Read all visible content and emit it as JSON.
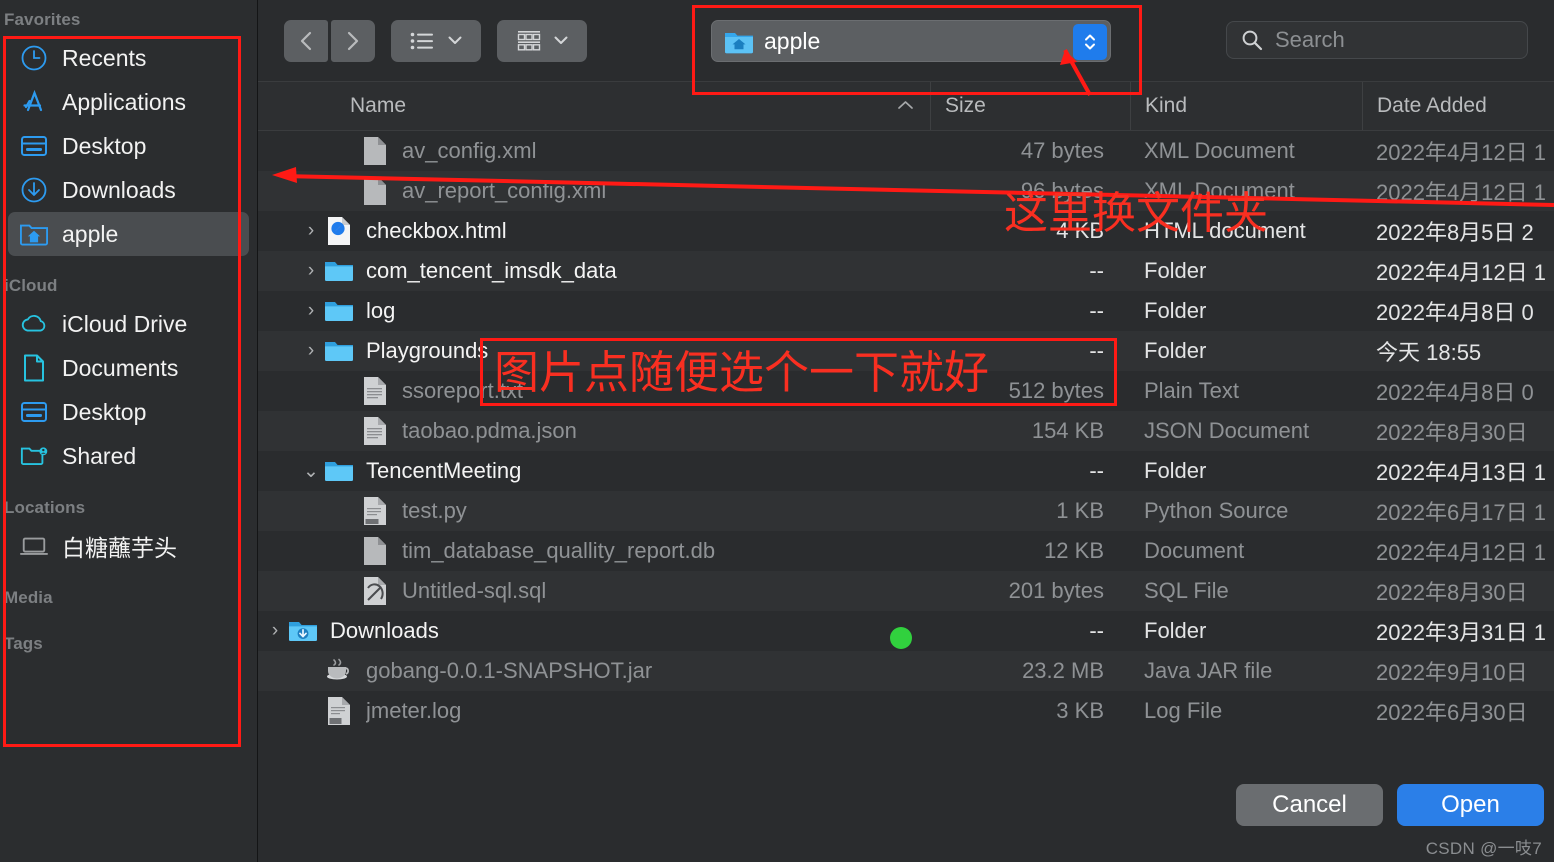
{
  "sidebar": {
    "sections": [
      {
        "header": "Favorites",
        "items": [
          {
            "label": "Recents",
            "icon": "clock-icon",
            "selected": false
          },
          {
            "label": "Applications",
            "icon": "appstore-icon",
            "selected": false
          },
          {
            "label": "Desktop",
            "icon": "desktop-icon",
            "selected": false
          },
          {
            "label": "Downloads",
            "icon": "download-icon",
            "selected": false
          },
          {
            "label": "apple",
            "icon": "home-folder-icon",
            "selected": true
          }
        ]
      },
      {
        "header": "iCloud",
        "items": [
          {
            "label": "iCloud Drive",
            "icon": "cloud-icon",
            "selected": false
          },
          {
            "label": "Documents",
            "icon": "document-icon",
            "selected": false
          },
          {
            "label": "Desktop",
            "icon": "desktop-icon",
            "selected": false
          },
          {
            "label": "Shared",
            "icon": "shared-folder-icon",
            "selected": false
          }
        ]
      },
      {
        "header": "Locations",
        "items": [
          {
            "label": "白糖蘸芋头",
            "icon": "laptop-icon",
            "selected": false
          }
        ]
      },
      {
        "header": "Media",
        "items": []
      },
      {
        "header": "Tags",
        "items": []
      }
    ]
  },
  "toolbar": {
    "back_icon": "chevron-left-icon",
    "forward_icon": "chevron-right-icon",
    "list_view_icon": "list-view-icon",
    "group_view_icon": "group-view-icon",
    "dropdown_icon": "chevron-down-icon",
    "path_popup": {
      "label": "apple",
      "folder_icon": "home-folder-icon",
      "stepper_icon": "stepper-updown-icon"
    },
    "search": {
      "placeholder": "Search",
      "icon": "search-icon"
    }
  },
  "columns": {
    "name": "Name",
    "sort_indicator": "chevron-up-icon",
    "size": "Size",
    "kind": "Kind",
    "date_added": "Date Added"
  },
  "files": [
    {
      "name": "av_config.xml",
      "size": "47 bytes",
      "kind": "XML Document",
      "date": "2022年4月12日 1",
      "icon": "file-generic-icon",
      "twisty": "",
      "enabled": false,
      "indent": 1,
      "dot": false
    },
    {
      "name": "av_report_config.xml",
      "size": "96 bytes",
      "kind": "XML Document",
      "date": "2022年4月12日 1",
      "icon": "file-generic-icon",
      "twisty": "",
      "enabled": false,
      "indent": 1,
      "dot": false
    },
    {
      "name": "checkbox.html",
      "size": "4 KB",
      "kind": "HTML document",
      "date": "2022年8月5日 2",
      "icon": "safari-html-icon",
      "twisty": "›",
      "enabled": true,
      "indent": 0,
      "dot": false
    },
    {
      "name": "com_tencent_imsdk_data",
      "size": "--",
      "kind": "Folder",
      "date": "2022年4月12日 1",
      "icon": "folder-icon",
      "twisty": "›",
      "enabled": true,
      "indent": 0,
      "dot": false
    },
    {
      "name": "log",
      "size": "--",
      "kind": "Folder",
      "date": "2022年4月8日 0",
      "icon": "folder-icon",
      "twisty": "›",
      "enabled": true,
      "indent": 0,
      "dot": false
    },
    {
      "name": "Playgrounds",
      "size": "--",
      "kind": "Folder",
      "date": "今天 18:55",
      "icon": "folder-icon",
      "twisty": "›",
      "enabled": true,
      "indent": 0,
      "dot": false
    },
    {
      "name": "ssoreport.txt",
      "size": "512 bytes",
      "kind": "Plain Text",
      "date": "2022年4月8日 0",
      "icon": "file-text-icon",
      "twisty": "",
      "enabled": false,
      "indent": 1,
      "dot": false
    },
    {
      "name": "taobao.pdma.json",
      "size": "154 KB",
      "kind": "JSON Document",
      "date": "2022年8月30日",
      "icon": "file-text-icon",
      "twisty": "",
      "enabled": false,
      "indent": 1,
      "dot": false
    },
    {
      "name": "TencentMeeting",
      "size": "--",
      "kind": "Folder",
      "date": "2022年4月13日 1",
      "icon": "folder-icon",
      "twisty": "⌄",
      "enabled": true,
      "indent": 0,
      "dot": false
    },
    {
      "name": "test.py",
      "size": "1 KB",
      "kind": "Python Source",
      "date": "2022年6月17日 1",
      "icon": "file-python-icon",
      "twisty": "",
      "enabled": false,
      "indent": 1,
      "dot": false
    },
    {
      "name": "tim_database_quallity_report.db",
      "size": "12 KB",
      "kind": "Document",
      "date": "2022年4月12日 1",
      "icon": "file-generic-icon",
      "twisty": "",
      "enabled": false,
      "indent": 1,
      "dot": false
    },
    {
      "name": "Untitled-sql.sql",
      "size": "201 bytes",
      "kind": "SQL File",
      "date": "2022年8月30日",
      "icon": "file-sql-icon",
      "twisty": "",
      "enabled": false,
      "indent": 1,
      "dot": false
    },
    {
      "name": "Downloads",
      "size": "--",
      "kind": "Folder",
      "date": "2022年3月31日 1",
      "icon": "downloads-folder-icon",
      "twisty": "›",
      "enabled": true,
      "indent": -1,
      "dot": true
    },
    {
      "name": "gobang-0.0.1-SNAPSHOT.jar",
      "size": "23.2 MB",
      "kind": "Java JAR file",
      "date": "2022年9月10日",
      "icon": "java-jar-icon",
      "twisty": "",
      "enabled": false,
      "indent": 0,
      "dot": false
    },
    {
      "name": "jmeter.log",
      "size": "3 KB",
      "kind": "Log File",
      "date": "2022年6月30日",
      "icon": "file-log-icon",
      "twisty": "",
      "enabled": false,
      "indent": 0,
      "dot": false
    }
  ],
  "footer": {
    "cancel_label": "Cancel",
    "open_label": "Open",
    "watermark": "CSDN @一吱7"
  },
  "annotations": {
    "change_folder_text": "这里换文件夹",
    "pick_image_text": "图片点随便选个一下就好",
    "accent_red": "#ff1a15"
  }
}
